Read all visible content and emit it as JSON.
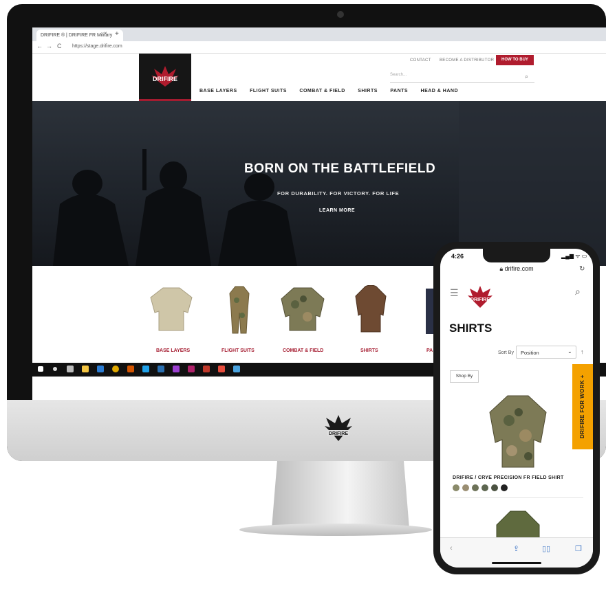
{
  "browser": {
    "tab_title": "DRIFIRE ® | DRIFIRE FR Military",
    "tab_close": "×",
    "new_tab": "+",
    "url": "https://stage.drifire.com",
    "nav_back": "←",
    "nav_forward": "→",
    "nav_reload": "C"
  },
  "site": {
    "top_links": [
      "CONTACT",
      "BECOME A DISTRIBUTOR"
    ],
    "how_to_buy": "HOW TO BUY",
    "search_placeholder": "Search...",
    "search_icon": "search-icon",
    "nav": [
      "BASE LAYERS",
      "FLIGHT SUITS",
      "COMBAT & FIELD",
      "SHIRTS",
      "PANTS",
      "HEAD & HAND"
    ],
    "hero": {
      "title": "BORN ON THE BATTLEFIELD",
      "subtitle": "FOR DURABILITY. FOR VICTORY. FOR LIFE",
      "button": "LEARN MORE"
    },
    "categories": [
      "BASE LAYERS",
      "FLIGHT SUITS",
      "COMBAT & FIELD",
      "SHIRTS",
      "PA"
    ]
  },
  "phone": {
    "time": "4:26",
    "status": "▂▄▆ ᯤ ▭",
    "url": "drifire.com",
    "reload_icon": "↻",
    "menu_icon": "☰",
    "search_icon": "⌕",
    "page_title": "SHIRTS",
    "sort_label": "Sort By",
    "sort_value": "Position",
    "sort_arrow": "⌄",
    "sort_dir": "↑",
    "shop_by": "Shop By",
    "side_tab": "DRIFIRE FOR WORK +",
    "product_name": "DRIFIRE / CRYE PRECISION FR FIELD SHIRT",
    "swatches": [
      "#8a8a6a",
      "#9a8e72",
      "#6d7258",
      "#5d6650",
      "#4b5241",
      "#222222"
    ],
    "bottom_icons": [
      "‹",
      "⇪",
      "▯▯",
      "❐"
    ]
  },
  "colors": {
    "brand_red": "#a51c30",
    "accent_orange": "#f4a100",
    "hero_bg": "#1f242b"
  }
}
